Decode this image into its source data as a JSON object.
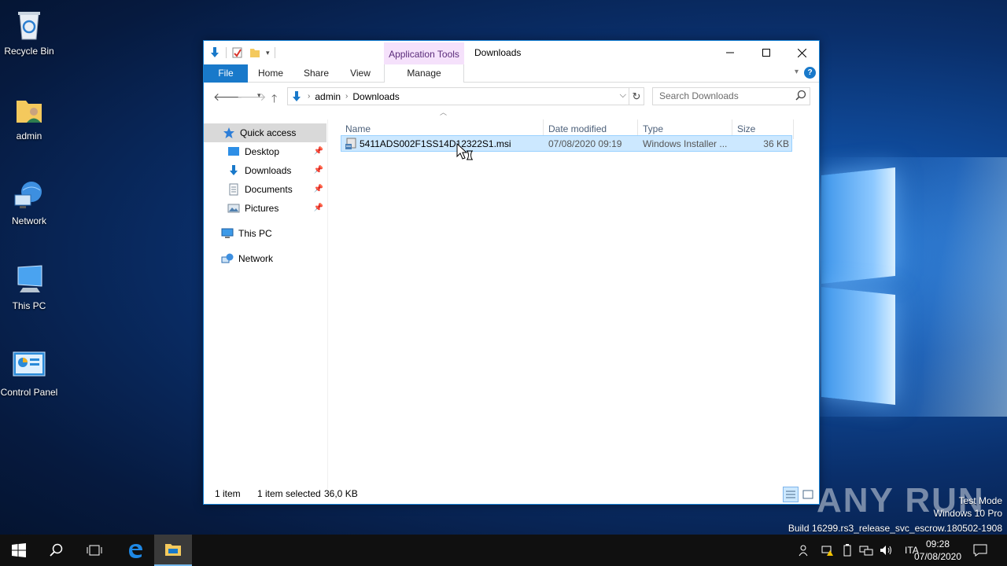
{
  "desktop": {
    "icons": [
      {
        "label": "Recycle Bin"
      },
      {
        "label": "admin"
      },
      {
        "label": "Network"
      },
      {
        "label": "This PC"
      },
      {
        "label": "Control Panel"
      }
    ]
  },
  "window": {
    "context_tab": "Application Tools",
    "title": "Downloads",
    "ribbon_tabs": {
      "file": "File",
      "home": "Home",
      "share": "Share",
      "view": "View",
      "manage": "Manage"
    },
    "help": "?",
    "address": {
      "crumb1": "admin",
      "crumb2": "Downloads"
    },
    "search_placeholder": "Search Downloads",
    "nav": {
      "quick_access": "Quick access",
      "desktop": "Desktop",
      "downloads": "Downloads",
      "documents": "Documents",
      "pictures": "Pictures",
      "this_pc": "This PC",
      "network": "Network"
    },
    "columns": {
      "name": "Name",
      "date": "Date modified",
      "type": "Type",
      "size": "Size"
    },
    "files": [
      {
        "name": "5411ADS002F1SS14D12322S1.msi",
        "date": "07/08/2020 09:19",
        "type": "Windows Installer ...",
        "size": "36 KB"
      }
    ],
    "status": {
      "count": "1 item",
      "selected": "1 item selected",
      "size": "36,0 KB"
    }
  },
  "watermark": "ANY RUN",
  "os_info": {
    "line1": "Test Mode",
    "line2": "Windows 10 Pro",
    "line3": "Build 16299.rs3_release_svc_escrow.180502-1908"
  },
  "taskbar": {
    "language": "ITA",
    "time": "09:28",
    "date": "07/08/2020"
  },
  "colors": {
    "accent": "#1979ca",
    "selection": "#cce8ff",
    "context_tab": "#f5e1fb"
  }
}
